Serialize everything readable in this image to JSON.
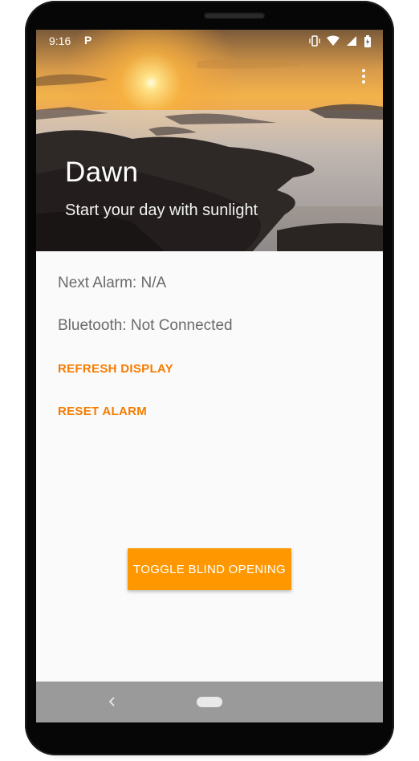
{
  "status_bar": {
    "time": "9:16",
    "notification_icon": "P"
  },
  "header": {
    "title": "Dawn",
    "subtitle": "Start your day with sunlight",
    "overflow_icon": "more-vert-icon"
  },
  "main": {
    "next_alarm": "Next Alarm: N/A",
    "bluetooth_status": "Bluetooth: Not Connected",
    "refresh_label": "REFRESH DISPLAY",
    "reset_label": "RESET ALARM",
    "toggle_label": "TOGGLE BLIND OPENING"
  },
  "colors": {
    "accent": "#f57c00",
    "button": "#ff9800",
    "nav_bar": "#9a9a9a"
  },
  "icons": [
    "vibrate-icon",
    "wifi-icon",
    "signal-icon",
    "battery-icon",
    "back-icon",
    "home-icon"
  ]
}
